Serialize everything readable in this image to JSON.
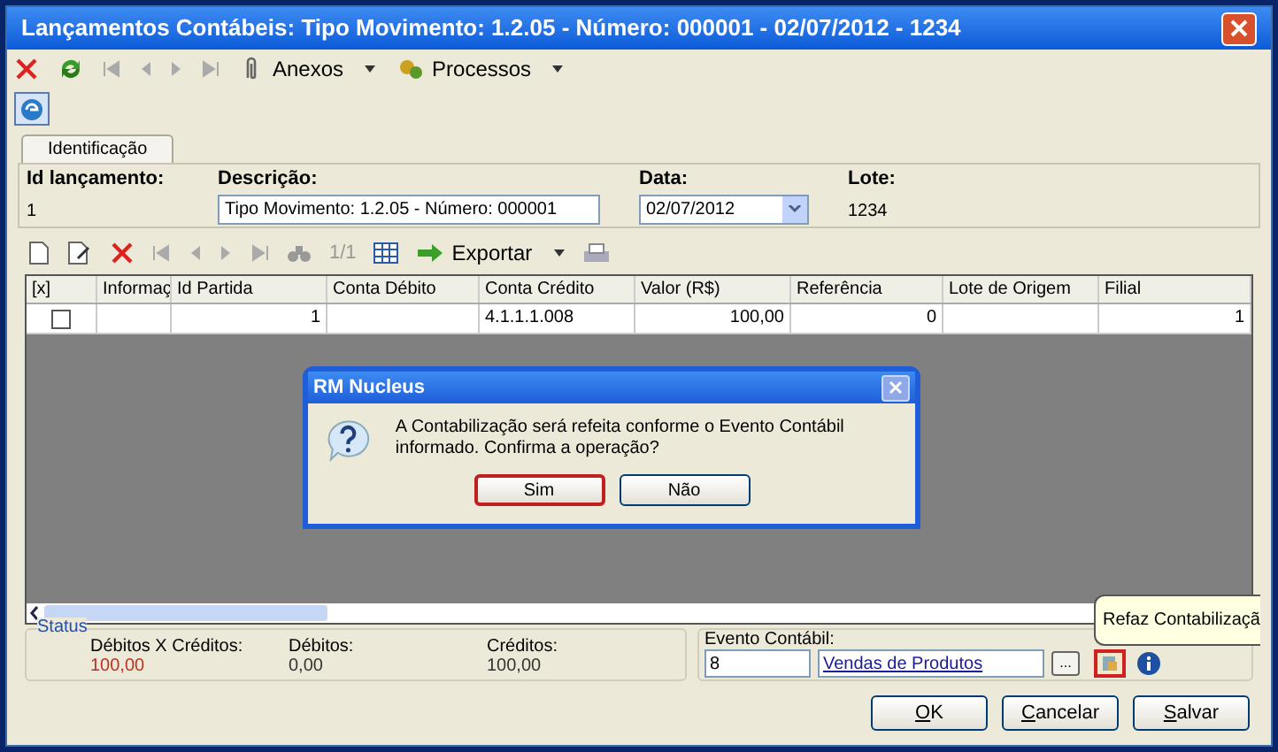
{
  "window": {
    "title": "Lançamentos Contábeis: Tipo Movimento: 1.2.05 - Número: 000001 - 02/07/2012 - 1234"
  },
  "toolbar": {
    "items": [
      {
        "kind": "delete"
      },
      {
        "kind": "refresh"
      },
      {
        "kind": "first"
      },
      {
        "kind": "prev"
      },
      {
        "kind": "next"
      },
      {
        "kind": "last"
      },
      {
        "kind": "menu",
        "label": "Anexos"
      },
      {
        "kind": "menu",
        "label": "Processos"
      }
    ]
  },
  "tabs": [
    {
      "label": "Identificação",
      "selected": true
    }
  ],
  "header": {
    "id_label": "Id lançamento:",
    "id_value": "1",
    "descricao_label": "Descrição:",
    "descricao_value": "Tipo Movimento: 1.2.05 - Número: 000001",
    "data_label": "Data:",
    "data_value": "02/07/2012",
    "lote_label": "Lote:",
    "lote_value": "1234"
  },
  "grid_toolbar": {
    "counter": "1/1",
    "export_label": "Exportar"
  },
  "table": {
    "columns": [
      "[x]",
      "Informaç",
      "Id Partida",
      "Conta Débito",
      "Conta Crédito",
      "Valor (R$)",
      "Referência",
      "Lote de Origem",
      "Filial"
    ],
    "rows": [
      {
        "checked": false,
        "cells": [
          "",
          "",
          "1",
          "",
          "4.1.1.1.008",
          "100,00",
          "0",
          "",
          "1"
        ]
      }
    ]
  },
  "dialog": {
    "title": "RM Nucleus",
    "message": "A Contabilização será refeita conforme o Evento Contábil informado. Confirma a operação?",
    "buttons": [
      {
        "label": "Sim",
        "selected": true
      },
      {
        "label": "Não",
        "selected": false
      }
    ]
  },
  "status": {
    "title": "Status",
    "items": [
      {
        "label": "Débitos X Créditos:",
        "value": "100,00",
        "color": "#c03020"
      },
      {
        "label": "Débitos:",
        "value": "0,00",
        "color": "#333333"
      },
      {
        "label": "Créditos:",
        "value": "100,00",
        "color": "#333333"
      }
    ]
  },
  "evento": {
    "label": "Evento Contábil:",
    "code": "8",
    "name": "Vendas de Produtos",
    "browse": "...",
    "tooltip": "Refaz Contabilizaçã"
  },
  "buttons": [
    "OK",
    "Cancelar",
    "Salvar"
  ]
}
